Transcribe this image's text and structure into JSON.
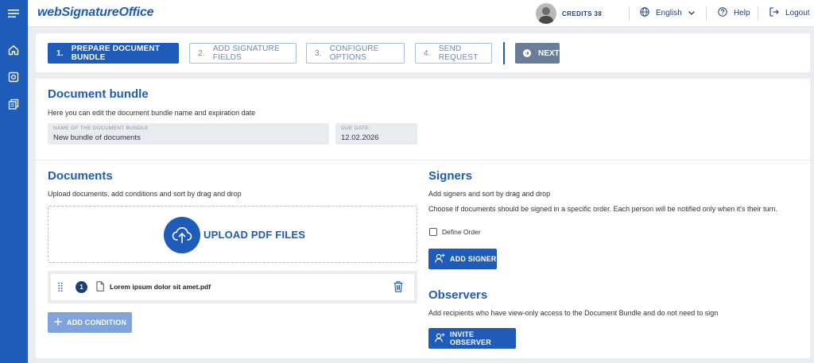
{
  "app": {
    "logo_text": "webSignatureOffice",
    "brand_color": "#1f5bb8"
  },
  "sidebar": {
    "items": [
      {
        "icon": "menu-icon"
      },
      {
        "icon": "home-icon"
      },
      {
        "icon": "safe-icon"
      },
      {
        "icon": "documents-stack-icon"
      }
    ]
  },
  "header": {
    "credits_text": "CREDITS 38",
    "language_label": "English",
    "help_label": "Help",
    "logout_label": "Logout"
  },
  "steps": [
    {
      "num": "1.",
      "label": "PREPARE DOCUMENT BUNDLE",
      "active": true
    },
    {
      "num": "2.",
      "label": "ADD SIGNATURE FIELDS",
      "active": false
    },
    {
      "num": "3.",
      "label": "CONFIGURE OPTIONS",
      "active": false
    },
    {
      "num": "4.",
      "label": "SEND REQUEST",
      "active": false
    }
  ],
  "next_label": "NEXT",
  "bundle": {
    "title": "Document bundle",
    "description": "Here you can edit the document bundle name and expiration date",
    "name_label": "NAME OF THE DOCUMENT BUNDLE",
    "name_value": "New bundle of documents",
    "due_label": "DUE DATE:",
    "due_value": "12.02.2026"
  },
  "documents": {
    "title": "Documents",
    "description": "Upload documents, add conditions and sort by drag and drop",
    "upload_label": "UPLOAD PDF FILES",
    "files": [
      {
        "num": "1",
        "name": "Lorem ipsum dolor sit amet.pdf"
      }
    ],
    "add_condition_label": "ADD CONDITION"
  },
  "signers": {
    "title": "Signers",
    "description": "Add signers and sort by drag and drop",
    "order_note": "Choose if documents should be signed in a specific order. Each person will be notified only when it's their turn.",
    "define_order_label": "Define Order",
    "define_order_checked": false,
    "add_signer_label": "ADD SIGNER"
  },
  "observers": {
    "title": "Observers",
    "description": "Add recipients who have view-only access to the Document Bundle and do not need to sign",
    "invite_label": "INVITE OBSERVER"
  }
}
